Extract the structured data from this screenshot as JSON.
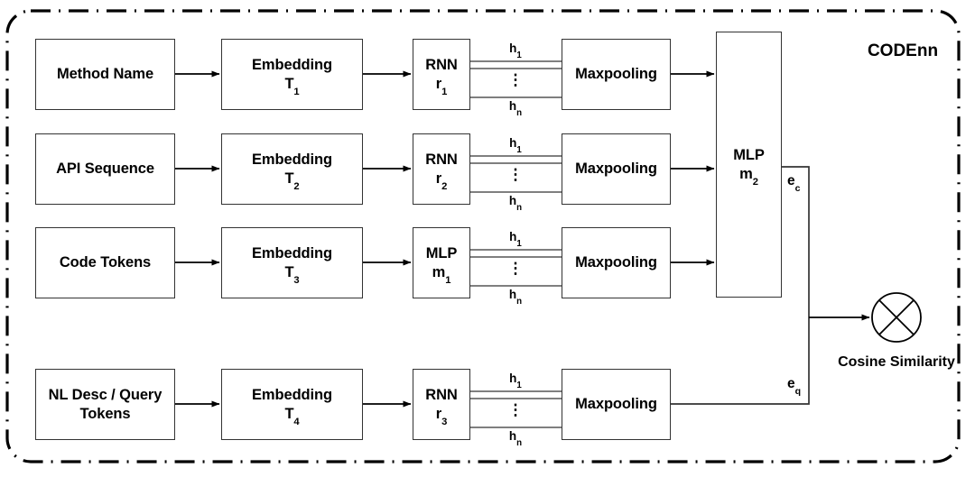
{
  "diagram": {
    "title": "CODEnn",
    "outer_border_style": "dash-dot rounded rectangle"
  },
  "rows": [
    {
      "input": {
        "label": "Method Name"
      },
      "embedding": {
        "label": "Embedding",
        "subscript_text": "T",
        "subscript_index": "1"
      },
      "encoder": {
        "label": "RNN",
        "subscript_text": "r",
        "subscript_index": "1"
      },
      "hidden_top": "h",
      "hidden_top_index": "1",
      "hidden_bottom": "h",
      "hidden_bottom_index": "n",
      "vertical_dots": "⋮",
      "pooling": {
        "label": "Maxpooling"
      }
    },
    {
      "input": {
        "label": "API Sequence"
      },
      "embedding": {
        "label": "Embedding",
        "subscript_text": "T",
        "subscript_index": "2"
      },
      "encoder": {
        "label": "RNN",
        "subscript_text": "r",
        "subscript_index": "2"
      },
      "hidden_top": "h",
      "hidden_top_index": "1",
      "hidden_bottom": "h",
      "hidden_bottom_index": "n",
      "vertical_dots": "⋮",
      "pooling": {
        "label": "Maxpooling"
      }
    },
    {
      "input": {
        "label": "Code Tokens"
      },
      "embedding": {
        "label": "Embedding",
        "subscript_text": "T",
        "subscript_index": "3"
      },
      "encoder": {
        "label": "MLP",
        "subscript_text": "m",
        "subscript_index": "1"
      },
      "hidden_top": "h",
      "hidden_top_index": "1",
      "hidden_bottom": "h",
      "hidden_bottom_index": "n",
      "vertical_dots": "⋮",
      "pooling": {
        "label": "Maxpooling"
      }
    },
    {
      "input": {
        "label_line1": "NL Desc / Query",
        "label_line2": "Tokens"
      },
      "embedding": {
        "label": "Embedding",
        "subscript_text": "T",
        "subscript_index": "4"
      },
      "encoder": {
        "label": "RNN",
        "subscript_text": "r",
        "subscript_index": "3"
      },
      "hidden_top": "h",
      "hidden_top_index": "1",
      "hidden_bottom": "h",
      "hidden_bottom_index": "n",
      "vertical_dots": "⋮",
      "pooling": {
        "label": "Maxpooling"
      }
    }
  ],
  "fusion": {
    "label": "MLP",
    "subscript_text": "m",
    "subscript_index": "2"
  },
  "edges": {
    "code_vector_label": "e",
    "code_vector_index": "c",
    "query_vector_label": "e",
    "query_vector_index": "q"
  },
  "output": {
    "operator_icon": "cross-circle-icon",
    "caption_line1": "Cosine",
    "caption_line2": "Similarity"
  },
  "colors": {
    "stroke": "#333333",
    "text": "#000000",
    "background": "#ffffff"
  }
}
